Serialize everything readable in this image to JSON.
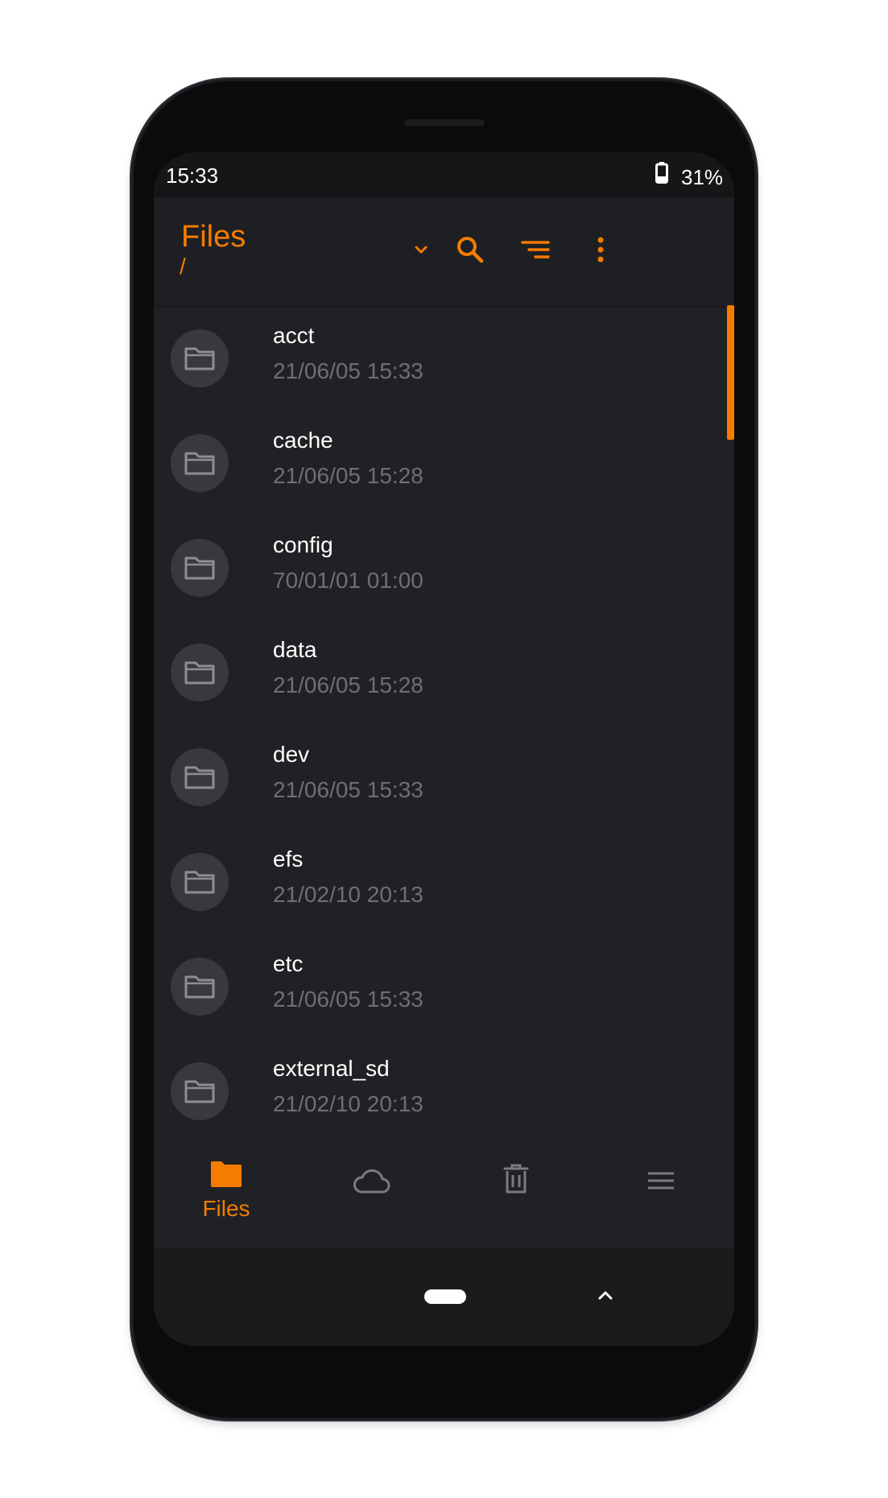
{
  "status_bar": {
    "time": "15:33",
    "battery_percent": "31%",
    "battery_icon": "battery-icon"
  },
  "app_bar": {
    "title": "Files",
    "path": "/",
    "actions": [
      "chevron-down-icon",
      "search-icon",
      "sort-icon",
      "more-vert-icon"
    ]
  },
  "files": [
    {
      "name": "acct",
      "date": "21/06/05 15:33",
      "icon": "folder-icon"
    },
    {
      "name": "cache",
      "date": "21/06/05 15:28",
      "icon": "folder-icon"
    },
    {
      "name": "config",
      "date": "70/01/01 01:00",
      "icon": "folder-icon"
    },
    {
      "name": "data",
      "date": "21/06/05 15:28",
      "icon": "folder-icon"
    },
    {
      "name": "dev",
      "date": "21/06/05 15:33",
      "icon": "folder-icon"
    },
    {
      "name": "efs",
      "date": "21/02/10 20:13",
      "icon": "folder-icon"
    },
    {
      "name": "etc",
      "date": "21/06/05 15:33",
      "icon": "folder-icon"
    },
    {
      "name": "external_sd",
      "date": "21/02/10 20:13",
      "icon": "folder-icon"
    }
  ],
  "bottom_nav": {
    "files_label": "Files",
    "items": [
      "folder-filled-icon",
      "cloud-icon",
      "trash-icon",
      "menu-icon"
    ],
    "active": "Files"
  },
  "colors": {
    "accent": "#f57c00",
    "background": "#202124",
    "avatar": "#38393c",
    "secondary_text": "#6e6f72",
    "inactive_icon": "#7a7b7e"
  }
}
